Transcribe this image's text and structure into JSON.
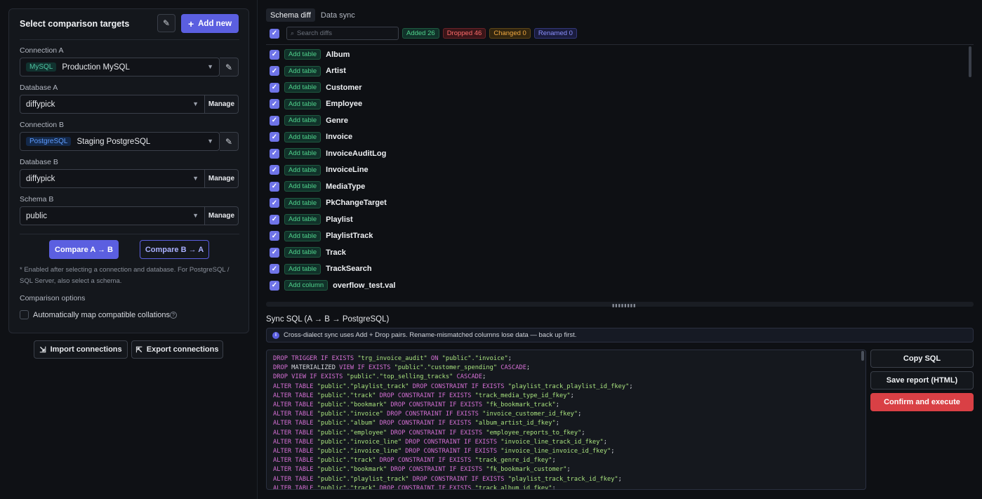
{
  "left": {
    "title": "Select comparison targets",
    "add_new": "Add new",
    "connection_a": {
      "label": "Connection A",
      "tag": "MySQL",
      "value": "Production MySQL"
    },
    "database_a": {
      "label": "Database A",
      "value": "diffypick",
      "manage": "Manage"
    },
    "connection_b": {
      "label": "Connection B",
      "tag": "PostgreSQL",
      "value": "Staging PostgreSQL"
    },
    "database_b": {
      "label": "Database B",
      "value": "diffypick",
      "manage": "Manage"
    },
    "schema_b": {
      "label": "Schema B",
      "value": "public",
      "manage": "Manage"
    },
    "compare_ab": "Compare A → B",
    "compare_ba": "Compare B → A",
    "note": "* Enabled after selecting a connection and database. For PostgreSQL / SQL Server, also select a schema.",
    "options_title": "Comparison options",
    "option_collations": "Automatically map compatible collations",
    "import": "Import connections",
    "export": "Export connections"
  },
  "tabs": [
    "Schema diff",
    "Data sync"
  ],
  "toolbar": {
    "search_placeholder": "Search diffs",
    "added": "Added 26",
    "dropped": "Dropped 46",
    "changed": "Changed 0",
    "renamed": "Renamed 0"
  },
  "diffs": [
    {
      "action": "Add table",
      "name": "Album"
    },
    {
      "action": "Add table",
      "name": "Artist"
    },
    {
      "action": "Add table",
      "name": "Customer"
    },
    {
      "action": "Add table",
      "name": "Employee"
    },
    {
      "action": "Add table",
      "name": "Genre"
    },
    {
      "action": "Add table",
      "name": "Invoice"
    },
    {
      "action": "Add table",
      "name": "InvoiceAuditLog"
    },
    {
      "action": "Add table",
      "name": "InvoiceLine"
    },
    {
      "action": "Add table",
      "name": "MediaType"
    },
    {
      "action": "Add table",
      "name": "PkChangeTarget"
    },
    {
      "action": "Add table",
      "name": "Playlist"
    },
    {
      "action": "Add table",
      "name": "PlaylistTrack"
    },
    {
      "action": "Add table",
      "name": "Track"
    },
    {
      "action": "Add table",
      "name": "TrackSearch"
    },
    {
      "action": "Add column",
      "name": "overflow_test.val"
    }
  ],
  "sync": {
    "title": "Sync SQL (A → B → PostgreSQL)",
    "banner": "Cross-dialect sync uses Add + Drop pairs. Rename-mismatched columns lose data — back up first.",
    "lines": [
      [
        [
          "kw",
          "DROP TRIGGER IF EXISTS "
        ],
        [
          "str",
          "\"trg_invoice_audit\""
        ],
        [
          "kw",
          " ON "
        ],
        [
          "str",
          "\"public\".\"invoice\""
        ],
        [
          "op",
          ";"
        ]
      ],
      [
        [
          "kw",
          "DROP "
        ],
        [
          "op",
          "MATERIALIZED "
        ],
        [
          "kw",
          "VIEW IF EXISTS "
        ],
        [
          "str",
          "\"public\".\"customer_spending\""
        ],
        [
          "kw",
          " CASCADE"
        ],
        [
          "op",
          ";"
        ]
      ],
      [
        [
          "kw",
          "DROP VIEW IF EXISTS "
        ],
        [
          "str",
          "\"public\".\"top_selling_tracks\""
        ],
        [
          "kw",
          " CASCADE"
        ],
        [
          "op",
          ";"
        ]
      ],
      [
        [
          "kw",
          "ALTER TABLE "
        ],
        [
          "str",
          "\"public\".\"playlist_track\""
        ],
        [
          "kw",
          " DROP CONSTRAINT IF EXISTS "
        ],
        [
          "str",
          "\"playlist_track_playlist_id_fkey\""
        ],
        [
          "op",
          ";"
        ]
      ],
      [
        [
          "kw",
          "ALTER TABLE "
        ],
        [
          "str",
          "\"public\".\"track\""
        ],
        [
          "kw",
          " DROP CONSTRAINT IF EXISTS "
        ],
        [
          "str",
          "\"track_media_type_id_fkey\""
        ],
        [
          "op",
          ";"
        ]
      ],
      [
        [
          "kw",
          "ALTER TABLE "
        ],
        [
          "str",
          "\"public\".\"bookmark\""
        ],
        [
          "kw",
          " DROP CONSTRAINT IF EXISTS "
        ],
        [
          "str",
          "\"fk_bookmark_track\""
        ],
        [
          "op",
          ";"
        ]
      ],
      [
        [
          "kw",
          "ALTER TABLE "
        ],
        [
          "str",
          "\"public\".\"invoice\""
        ],
        [
          "kw",
          " DROP CONSTRAINT IF EXISTS "
        ],
        [
          "str",
          "\"invoice_customer_id_fkey\""
        ],
        [
          "op",
          ";"
        ]
      ],
      [
        [
          "kw",
          "ALTER TABLE "
        ],
        [
          "str",
          "\"public\".\"album\""
        ],
        [
          "kw",
          " DROP CONSTRAINT IF EXISTS "
        ],
        [
          "str",
          "\"album_artist_id_fkey\""
        ],
        [
          "op",
          ";"
        ]
      ],
      [
        [
          "kw",
          "ALTER TABLE "
        ],
        [
          "str",
          "\"public\".\"employee\""
        ],
        [
          "kw",
          " DROP CONSTRAINT IF EXISTS "
        ],
        [
          "str",
          "\"employee_reports_to_fkey\""
        ],
        [
          "op",
          ";"
        ]
      ],
      [
        [
          "kw",
          "ALTER TABLE "
        ],
        [
          "str",
          "\"public\".\"invoice_line\""
        ],
        [
          "kw",
          " DROP CONSTRAINT IF EXISTS "
        ],
        [
          "str",
          "\"invoice_line_track_id_fkey\""
        ],
        [
          "op",
          ";"
        ]
      ],
      [
        [
          "kw",
          "ALTER TABLE "
        ],
        [
          "str",
          "\"public\".\"invoice_line\""
        ],
        [
          "kw",
          " DROP CONSTRAINT IF EXISTS "
        ],
        [
          "str",
          "\"invoice_line_invoice_id_fkey\""
        ],
        [
          "op",
          ";"
        ]
      ],
      [
        [
          "kw",
          "ALTER TABLE "
        ],
        [
          "str",
          "\"public\".\"track\""
        ],
        [
          "kw",
          " DROP CONSTRAINT IF EXISTS "
        ],
        [
          "str",
          "\"track_genre_id_fkey\""
        ],
        [
          "op",
          ";"
        ]
      ],
      [
        [
          "kw",
          "ALTER TABLE "
        ],
        [
          "str",
          "\"public\".\"bookmark\""
        ],
        [
          "kw",
          " DROP CONSTRAINT IF EXISTS "
        ],
        [
          "str",
          "\"fk_bookmark_customer\""
        ],
        [
          "op",
          ";"
        ]
      ],
      [
        [
          "kw",
          "ALTER TABLE "
        ],
        [
          "str",
          "\"public\".\"playlist_track\""
        ],
        [
          "kw",
          " DROP CONSTRAINT IF EXISTS "
        ],
        [
          "str",
          "\"playlist_track_track_id_fkey\""
        ],
        [
          "op",
          ";"
        ]
      ],
      [
        [
          "kw",
          "ALTER TABLE "
        ],
        [
          "str",
          "\"public\".\"track\""
        ],
        [
          "kw",
          " DROP CONSTRAINT IF EXISTS "
        ],
        [
          "str",
          "\"track_album_id_fkey\""
        ],
        [
          "op",
          ";"
        ]
      ]
    ],
    "copy": "Copy SQL",
    "save": "Save report (HTML)",
    "execute": "Confirm and execute"
  },
  "icons": {
    "edit": "pencil-icon",
    "plus": "plus-icon",
    "chevron": "chevron-down-icon",
    "search": "search-icon",
    "check": "check-icon",
    "info": "info-icon",
    "import": "import-icon",
    "export": "export-icon",
    "help": "help-icon"
  },
  "colors": {
    "accent": "#5b5fe0",
    "added": "#4fd18b",
    "dropped": "#ff6b6b",
    "changed": "#f0a840",
    "renamed": "#8b90ff",
    "danger": "#d94045"
  }
}
